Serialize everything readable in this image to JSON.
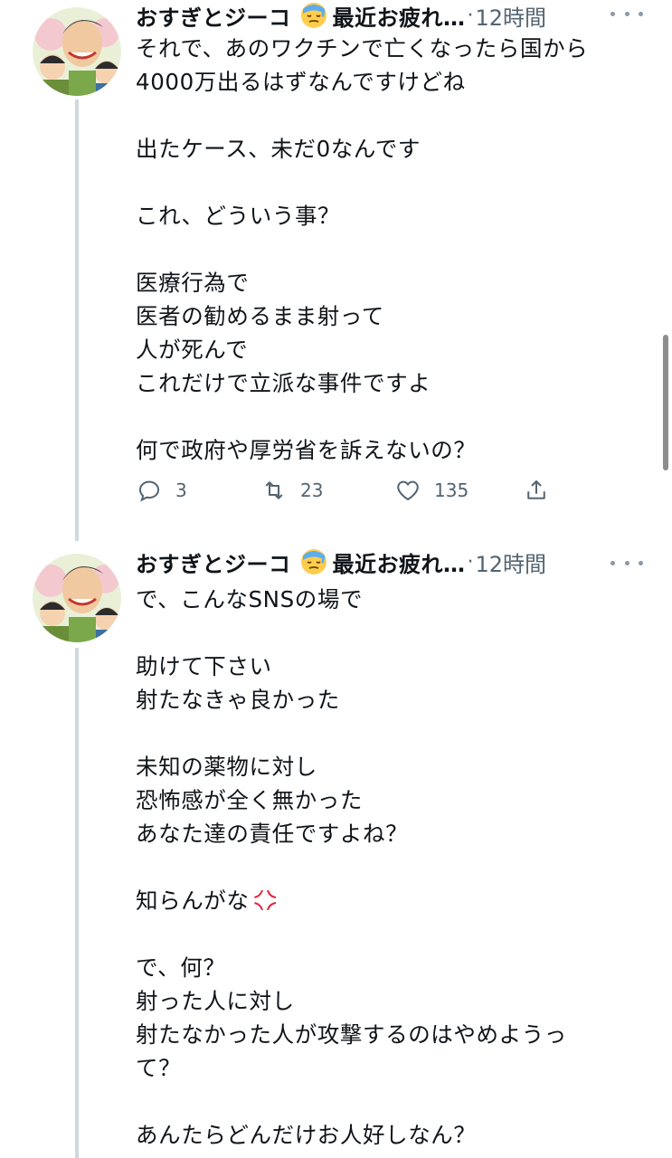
{
  "tweets": [
    {
      "author": "おすぎとジーコ",
      "author_suffix": "最近お疲れ…",
      "dot": "·",
      "time": "12時間",
      "lines": [
        "それで、あのワクチンで亡くなったら国から",
        "4000万出るはずなんですけどね",
        "",
        "出たケース、未だ0なんです",
        "",
        "これ、どういう事？",
        "",
        "医療行為で",
        "医者の勧めるまま射って",
        "人が死んで",
        "これだけで立派な事件ですよ",
        "",
        "何で政府や厚労省を訴えないの？"
      ],
      "replies": "3",
      "retweets": "23",
      "likes": "135"
    },
    {
      "author": "おすぎとジーコ",
      "author_suffix": "最近お疲れ…",
      "dot": "·",
      "time": "12時間",
      "lines": [
        "で、こんなSNSの場で",
        "",
        "助けて下さい",
        "射たなきゃ良かった",
        "",
        "未知の薬物に対し",
        "恐怖感が全く無かった",
        "あなた達の責任ですよね？",
        "",
        "知らんがな",
        "",
        "で、何？",
        "射った人に対し",
        "射たなかった人が攻撃するのはやめようっ",
        "て？",
        "",
        "あんたらどんだけお人好しなん？"
      ]
    }
  ],
  "icons": {
    "emoji": "sweat-face-emoji",
    "anger": "anger-symbol-emoji",
    "reply": "reply-icon",
    "retweet": "retweet-icon",
    "like": "heart-icon",
    "share": "share-icon",
    "more": "more-icon"
  },
  "colors": {
    "text": "#0f1419",
    "secondary": "#536471",
    "thread_line": "#cfd9de",
    "anger": "#e0263a"
  }
}
